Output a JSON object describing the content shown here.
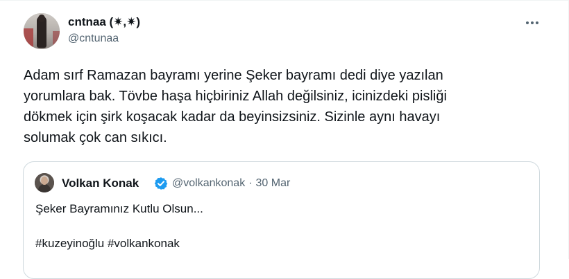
{
  "tweet": {
    "author": {
      "display_name": "cntnaa (✷,✷)",
      "handle": "@cntunaa"
    },
    "more_icon": "more-horizontal-icon",
    "text_lines": [
      "Adam sırf Ramazan bayramı yerine Şeker bayramı dedi diye yazılan",
      "yorumlara bak. Tövbe haşa hiçbiriniz Allah değilsiniz, icinizdeki pisliği",
      "dökmek için şirk koşacak kadar da beyinsizsiniz. Sizinle aynı havayı",
      "solumak çok can sıkıcı."
    ]
  },
  "quote": {
    "author": {
      "display_name": "Volkan Konak",
      "handle": "@volkankonak",
      "separator": "·",
      "date": "30 Mar"
    },
    "verified_icon": "verified-badge-icon",
    "verified_color": "#1d9bf0",
    "text": "Şeker Bayramınız Kutlu Olsun...",
    "hashtags": "#kuzeyinoğlu #volkankonak"
  }
}
